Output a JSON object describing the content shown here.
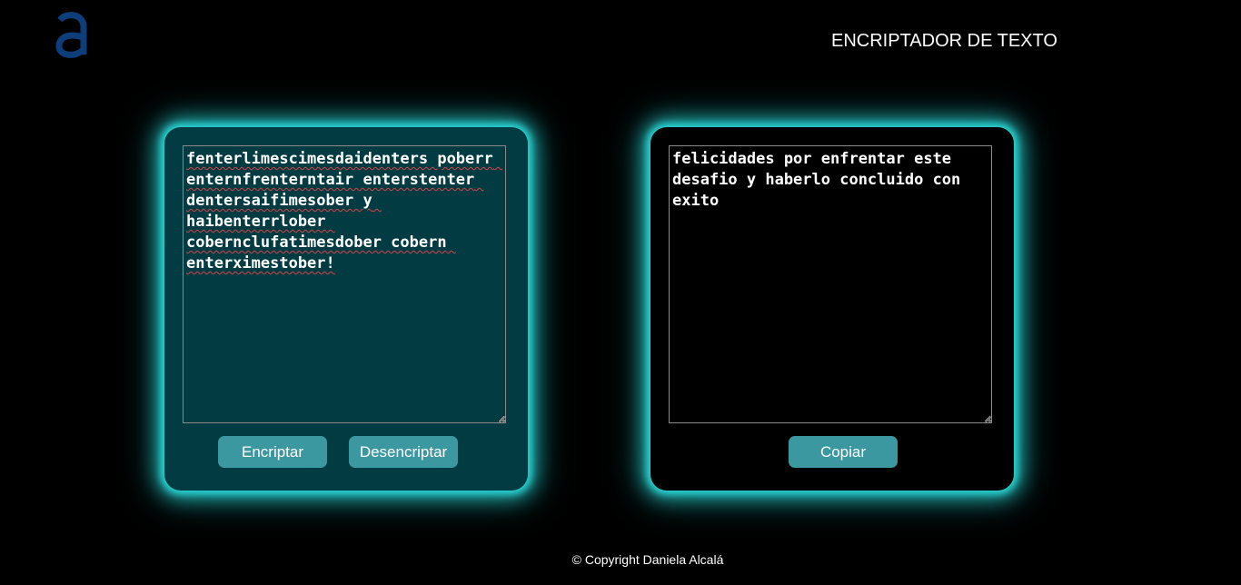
{
  "header": {
    "logo_icon": "alura-a-logo",
    "title": "ENCRIPTADOR DE TEXTO"
  },
  "input_panel": {
    "text": "fenterlimescimesdaidenters poberr enternfrenterntair enterstenter dentersaifimesober y haibenterrlober cobernclufatimesdober cobern enterximestober!",
    "encrypt_label": "Encriptar",
    "decrypt_label": "Desencriptar"
  },
  "output_panel": {
    "text": "felicidades por enfrentar este desafio y haberlo concluido con exito",
    "copy_label": "Copiar"
  },
  "footer": {
    "copyright": "© Copyright Daniela Alcalá"
  },
  "colors": {
    "background": "#000000",
    "input_panel": "#023b42",
    "glow": "#2ad3d3",
    "button": "#3b98a1",
    "logo": "#0e3e7a"
  }
}
